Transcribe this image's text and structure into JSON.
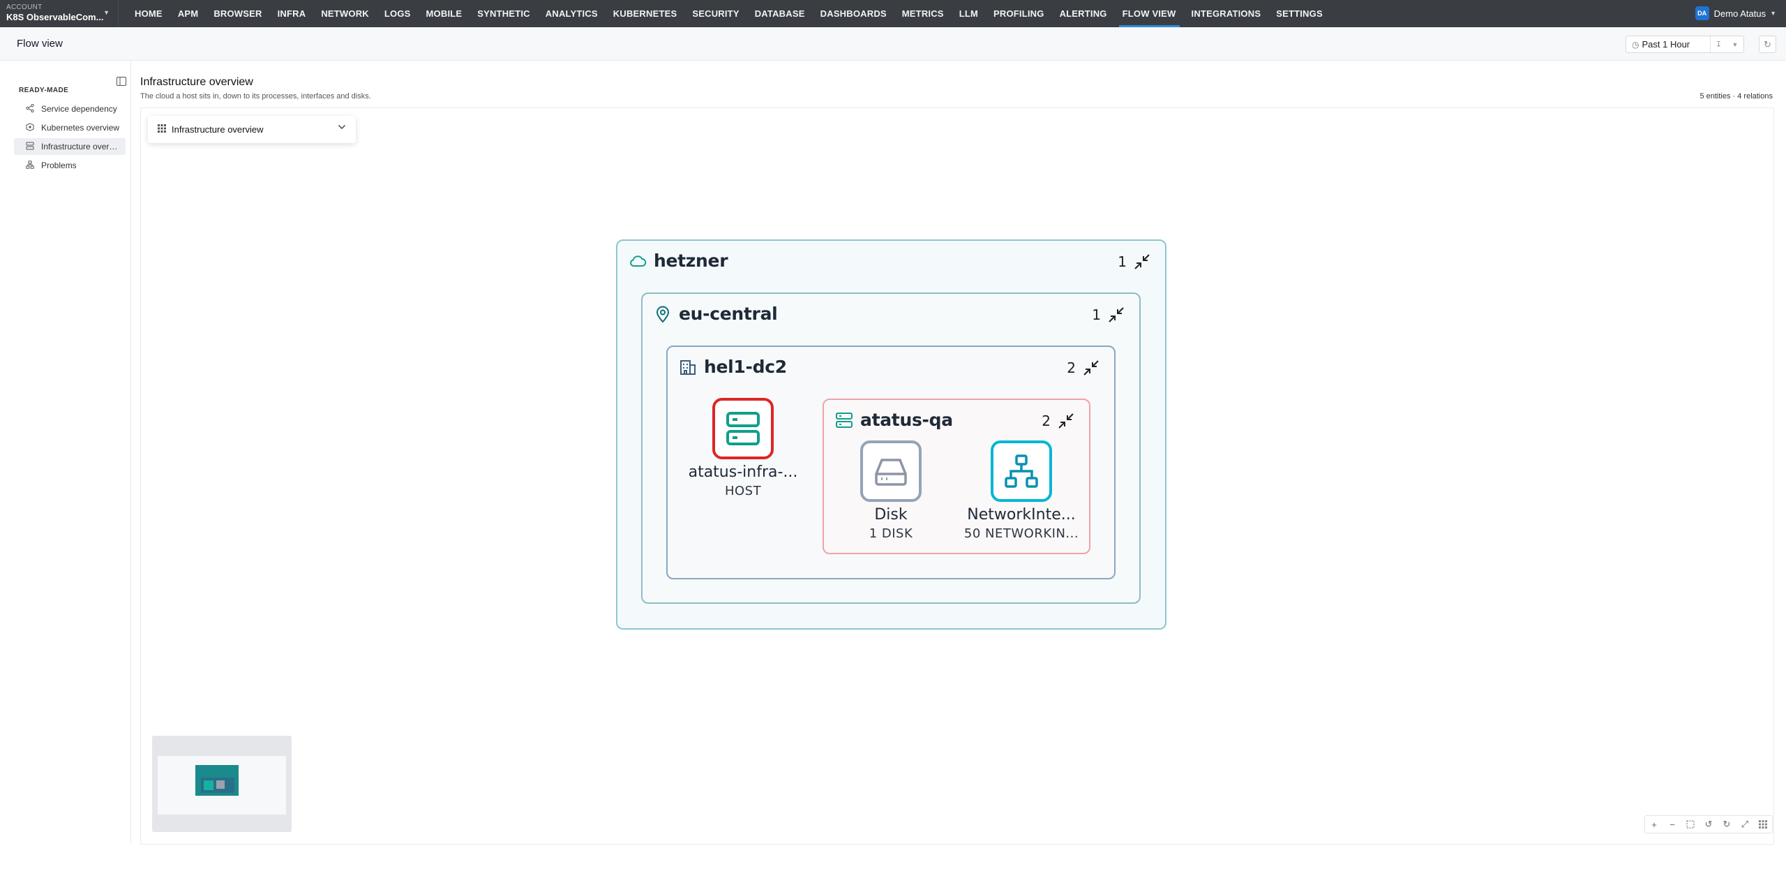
{
  "account": {
    "label": "ACCOUNT",
    "name": "K8S ObservableCom..."
  },
  "nav": {
    "items": [
      "HOME",
      "APM",
      "BROWSER",
      "INFRA",
      "NETWORK",
      "LOGS",
      "MOBILE",
      "SYNTHETIC",
      "ANALYTICS",
      "KUBERNETES",
      "SECURITY",
      "DATABASE",
      "DASHBOARDS",
      "METRICS",
      "LLM",
      "PROFILING",
      "ALERTING",
      "FLOW VIEW",
      "INTEGRATIONS",
      "SETTINGS"
    ],
    "active": "FLOW VIEW"
  },
  "user": {
    "initials": "DA",
    "name": "Demo Atatus"
  },
  "page": {
    "title": "Flow view",
    "time_range": "Past 1 Hour"
  },
  "sidebar": {
    "heading": "READY-MADE",
    "items": [
      {
        "label": "Service dependency",
        "icon": "share-nodes-icon"
      },
      {
        "label": "Kubernetes overview",
        "icon": "kubernetes-icon"
      },
      {
        "label": "Infrastructure overview",
        "icon": "server-icon",
        "active": true
      },
      {
        "label": "Problems",
        "icon": "sitemap-icon"
      }
    ]
  },
  "main": {
    "title": "Infrastructure overview",
    "subtitle": "The cloud a host sits in, down to its processes, interfaces and disks.",
    "stats": "5 entities · 4 relations",
    "selector": "Infrastructure overview"
  },
  "graph": {
    "cloud": {
      "label": "hetzner",
      "count": "1"
    },
    "region": {
      "label": "eu-central",
      "count": "1"
    },
    "datacenter": {
      "label": "hel1-dc2",
      "count": "2"
    },
    "host_group": {
      "label": "atatus-qa",
      "count": "2"
    },
    "host": {
      "name": "atatus-infra-...",
      "sub": "HOST",
      "color": "#dc2626"
    },
    "disk": {
      "name": "Disk",
      "sub": "1 DISK",
      "color": "#94a3b8"
    },
    "network": {
      "name": "NetworkInte...",
      "sub": "50 NETWORKIN...",
      "color": "#06b6d4"
    }
  },
  "colors": {
    "accent": "#2b8bd6",
    "teal": "#0f9f8c"
  }
}
